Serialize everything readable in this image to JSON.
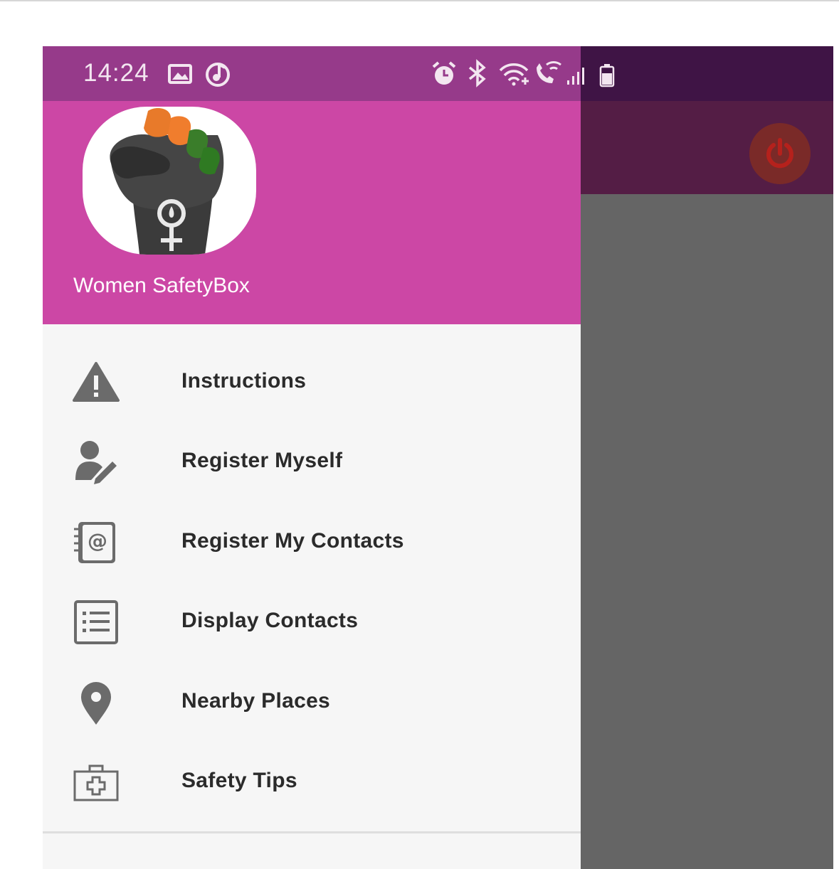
{
  "status_bar": {
    "time": "14:24",
    "icons": [
      "gallery-icon",
      "music-icon",
      "alarm-icon",
      "bluetooth-icon",
      "wifi-icon",
      "wifi-call-icon",
      "signal-icon",
      "battery-icon"
    ]
  },
  "background_app": {
    "action_icon": "power-icon"
  },
  "drawer": {
    "header": {
      "logo": "raised-fist-female-symbol-logo",
      "app_name": "Women SafetyBox"
    },
    "items": [
      {
        "label": "Instructions",
        "icon": "warning-icon"
      },
      {
        "label": "Register Myself",
        "icon": "user-edit-icon"
      },
      {
        "label": "Register My Contacts",
        "icon": "address-book-icon"
      },
      {
        "label": "Display Contacts",
        "icon": "list-icon"
      },
      {
        "label": "Nearby Places",
        "icon": "location-pin-icon"
      },
      {
        "label": "Safety Tips",
        "icon": "first-aid-kit-icon"
      }
    ]
  },
  "colors": {
    "status_bar": "#963a8a",
    "header": "#cc47a5",
    "drawer_bg": "#f6f6f6",
    "scrim": "#656565",
    "icon_gray": "#6b6b6b"
  }
}
